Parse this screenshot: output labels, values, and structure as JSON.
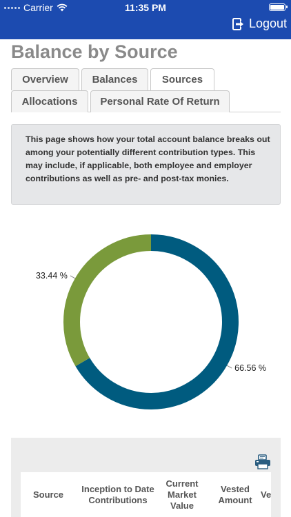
{
  "status_bar": {
    "carrier": "Carrier",
    "time": "11:35 PM"
  },
  "header": {
    "logout_label": "Logout"
  },
  "page": {
    "title": "Balance by Source"
  },
  "tabs": [
    {
      "label": "Overview"
    },
    {
      "label": "Balances"
    },
    {
      "label": "Sources",
      "active": true
    },
    {
      "label": "Allocations"
    },
    {
      "label": "Personal Rate Of Return"
    }
  ],
  "info_text": "This page shows how your total account balance breaks out among your potentially different contribution types. This may include, if applicable, both employee and employer contributions as well as pre- and post-tax monies.",
  "colors": {
    "header": "#1c4bb0",
    "series_1": "#005b7f",
    "series_2": "#7a9a3b"
  },
  "chart_data": {
    "type": "pie",
    "donut": true,
    "slices": [
      {
        "value": 66.56,
        "label": "66.56 %",
        "color": "#005b7f"
      },
      {
        "value": 33.44,
        "label": "33.44 %",
        "color": "#7a9a3b"
      }
    ]
  },
  "table": {
    "columns": [
      "Source",
      "Inception to Date Contributions",
      "Current Market Value",
      "Vested Amount",
      "Ve"
    ]
  },
  "icons": {
    "print": "printer-icon",
    "logout": "logout-icon"
  }
}
